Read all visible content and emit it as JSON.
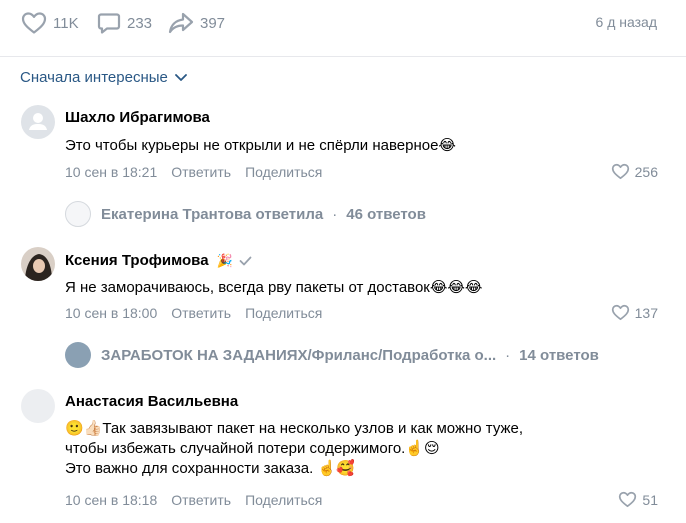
{
  "post_stats": {
    "likes": "11K",
    "comments": "233",
    "shares": "397",
    "time": "6 д назад"
  },
  "sort": {
    "label": "Сначала интересные"
  },
  "comments": [
    {
      "author": "Шахло Ибрагимова",
      "text": "Это чтобы курьеры не открыли и не спёрли наверное😂",
      "date": "10 сен в 18:21",
      "reply_label": "Ответить",
      "share_label": "Поделиться",
      "likes": "256",
      "thread": {
        "name": "Екатерина Трантова ответила",
        "count": "46 ответов"
      }
    },
    {
      "author": "Ксения Трофимова",
      "badge": "🎉",
      "text": "Я не заморачиваюсь, всегда рву пакеты от доставок😂😂😂",
      "date": "10 сен в 18:00",
      "reply_label": "Ответить",
      "share_label": "Поделиться",
      "likes": "137",
      "thread": {
        "name": "ЗАРАБОТОК НА ЗАДАНИЯХ/Фриланс/Подработка о...",
        "count": "14 ответов"
      }
    },
    {
      "author": "Анастасия Васильевна",
      "text_lines": [
        "🙂👍🏻Так завязывают пакет на несколько узлов и как можно туже,",
        "чтобы избежать случайной потери содержимого.☝️😌",
        "Это важно для сохранности заказа. ☝️🥰"
      ],
      "date": "10 сен в 18:18",
      "reply_label": "Ответить",
      "share_label": "Поделиться",
      "likes": "51"
    }
  ],
  "colors": {
    "accent": "#2a5885",
    "muted": "#818c99",
    "divider": "#e7e8ec"
  }
}
